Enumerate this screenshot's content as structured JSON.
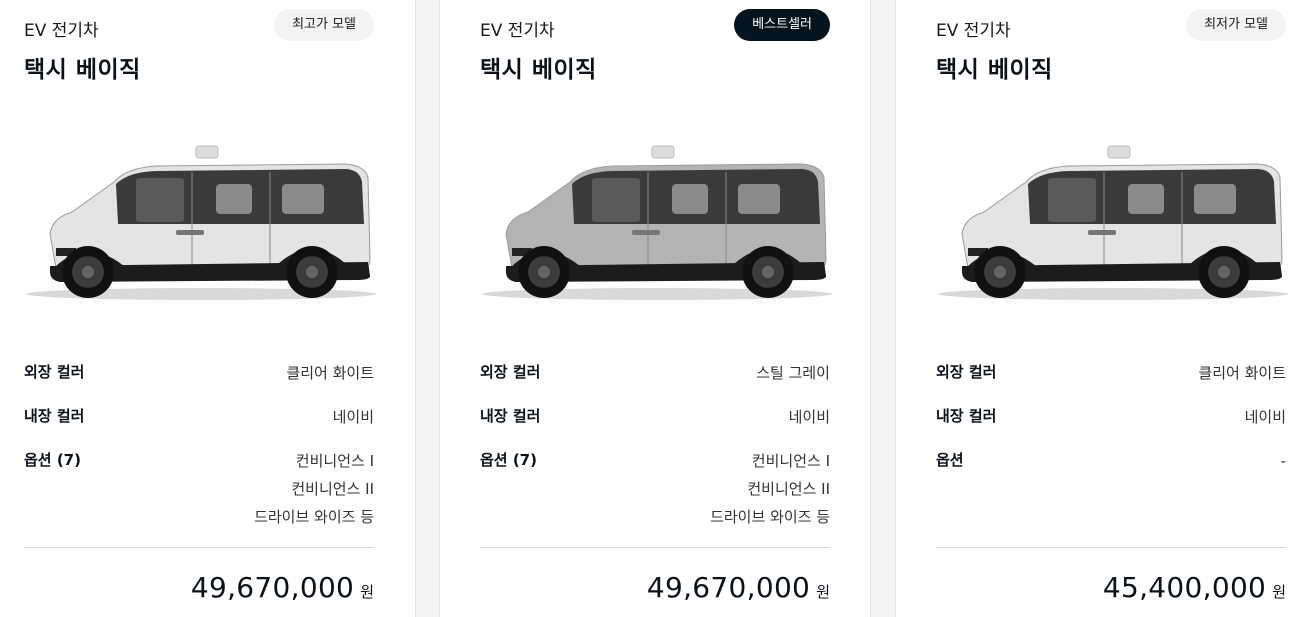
{
  "cards": [
    {
      "category": "EV 전기차",
      "model": "택시 베이직",
      "badge": "최고가 모델",
      "exterior_label": "외장 컬러",
      "exterior_value": "클리어 화이트",
      "interior_label": "내장 컬러",
      "interior_value": "네이비",
      "options_label": "옵션 (7)",
      "options": [
        "컨비니언스 I",
        "컨비니언스 II",
        "드라이브 와이즈 등"
      ],
      "price": "49,670,000",
      "currency": "원",
      "body_color": "#e4e4e4"
    },
    {
      "category": "EV 전기차",
      "model": "택시 베이직",
      "badge": "베스트셀러",
      "exterior_label": "외장 컬러",
      "exterior_value": "스틸 그레이",
      "interior_label": "내장 컬러",
      "interior_value": "네이비",
      "options_label": "옵션 (7)",
      "options": [
        "컨비니언스 I",
        "컨비니언스 II",
        "드라이브 와이즈 등"
      ],
      "price": "49,670,000",
      "currency": "원",
      "body_color": "#b3b3b3"
    },
    {
      "category": "EV 전기차",
      "model": "택시 베이직",
      "badge": "최저가 모델",
      "exterior_label": "외장 컬러",
      "exterior_value": "클리어 화이트",
      "interior_label": "내장 컬러",
      "interior_value": "네이비",
      "options_label": "옵션",
      "options": [
        "-"
      ],
      "price": "45,400,000",
      "currency": "원",
      "body_color": "#e4e4e4"
    }
  ]
}
